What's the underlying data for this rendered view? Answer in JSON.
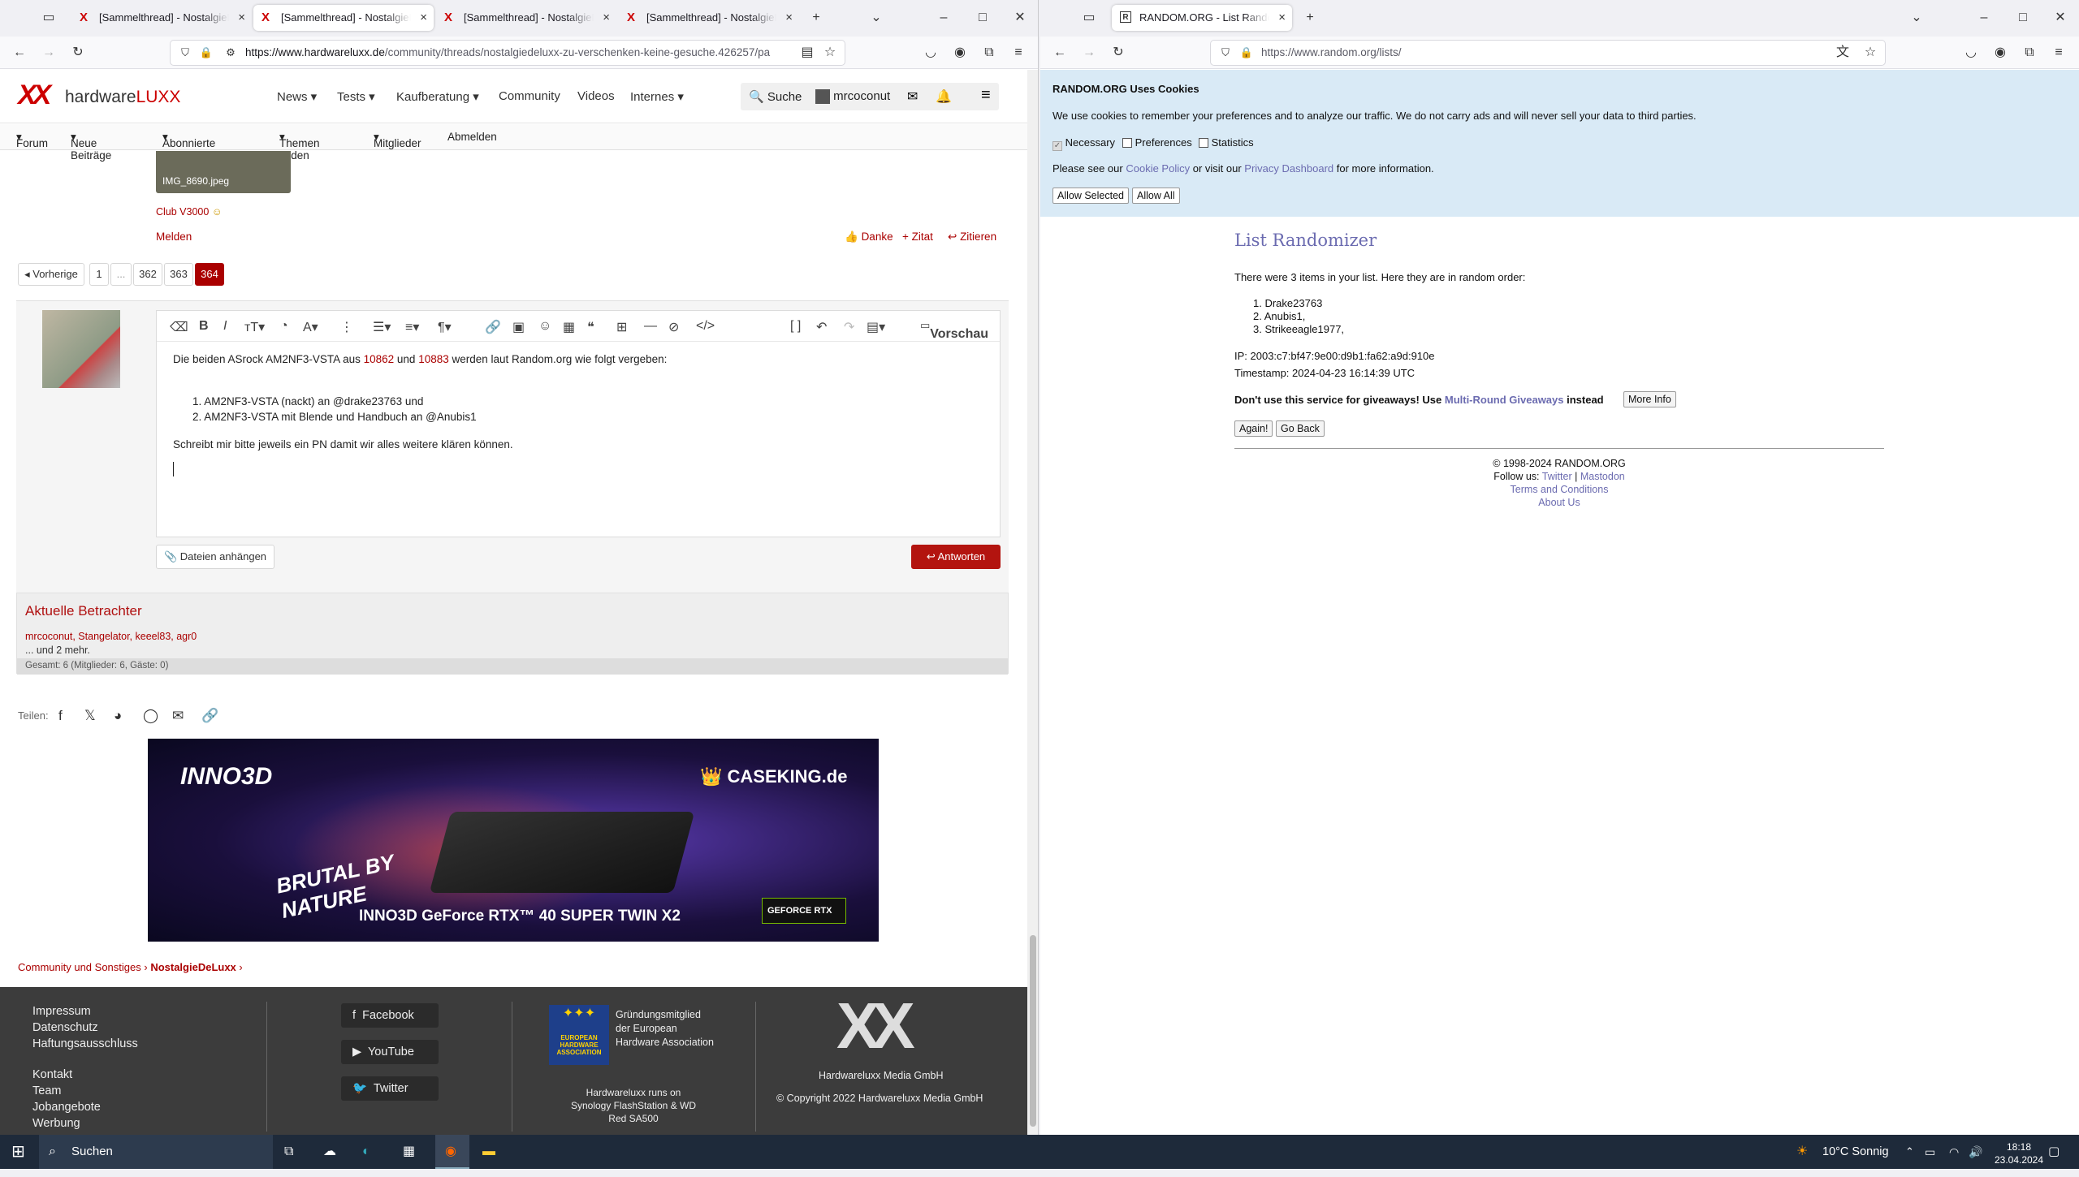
{
  "left_browser": {
    "tabs": [
      {
        "title": "[Sammelthread] - NostalgieDeluxx"
      },
      {
        "title": "[Sammelthread] - NostalgieDeluxx"
      },
      {
        "title": "[Sammelthread] - NostalgieDeluxx"
      },
      {
        "title": "[Sammelthread] - NostalgieDeluxx"
      }
    ],
    "url_host": "https://www.hardwareluxx.de",
    "url_path": "/community/threads/nostalgiedeluxx-zu-verschenken-keine-gesuche.426257/pa"
  },
  "site": {
    "logo_xx": "XX",
    "logo_brand1": "hardware",
    "logo_brand2": "LUXX",
    "nav": [
      "News",
      "Tests",
      "Kaufberatung",
      "Community",
      "Videos",
      "Internes"
    ],
    "search_label": "Suche",
    "user": "mrcoconut",
    "subnav": [
      "Forum",
      "Neue Beiträge",
      "Abonnierte Themen",
      "Themen finden",
      "Mitglieder",
      "Abmelden"
    ],
    "attachment_name": "IMG_8690.jpeg",
    "signature": "Club V3000",
    "report": "Melden",
    "thanks": "Danke",
    "quote_plus": "+ Zitat",
    "quote": "Zitieren",
    "pagination": {
      "prev": "Vorherige",
      "pages": [
        "1",
        "...",
        "362",
        "363",
        "364"
      ]
    },
    "preview": "Vorschau",
    "editor": {
      "line1_a": "Die beiden ASrock AM2NF3-VSTA aus ",
      "link1": "10862",
      "line1_b": " und ",
      "link2": "10883",
      "line1_c": " werden laut Random.org wie folgt vergeben:",
      "item1": "1. AM2NF3-VSTA (nackt) an @drake23763 und",
      "item2": "2. AM2NF3-VSTA mit Blende und Handbuch an @Anubis1",
      "line3": "Schreibt mir bitte jeweils ein PN damit wir alles weitere klären können."
    },
    "attach_btn": "Dateien anhängen",
    "reply_btn": "Antworten",
    "viewers": {
      "title": "Aktuelle Betrachter",
      "names": "mrcoconut, Stangelator, keeel83, agr0",
      "more": "... und 2 mehr.",
      "total": "Gesamt: 6 (Mitglieder: 6, Gäste: 0)"
    },
    "share": "Teilen:",
    "ad": {
      "brand": "INNO3D",
      "shop": "CASEKING.de",
      "slogan": "BRUTAL BY NATURE",
      "product": "INNO3D GeForce RTX™ 40 SUPER TWIN X2",
      "badge": "GEFORCE RTX"
    },
    "breadcrumb": [
      "Community und Sonstiges",
      "NostalgieDeLuxx"
    ],
    "footer": {
      "col1": [
        "Impressum",
        "Datenschutz",
        "Haftungsausschluss"
      ],
      "col1b": [
        "Kontakt",
        "Team",
        "Jobangebote",
        "Werbung"
      ],
      "social": [
        "Facebook",
        "YouTube",
        "Twitter"
      ],
      "eha_text": "Gründungsmitglied der European Hardware Association",
      "eha_logo": "EUROPEAN HARDWARE ASSOCIATION",
      "synology": "Hardwareluxx runs on Synology FlashStation & WD Red SA500",
      "company": "Hardwareluxx Media GmbH",
      "copyright": "© Copyright 2022 Hardwareluxx Media GmbH"
    }
  },
  "right_browser": {
    "tab_title": "RANDOM.ORG - List Randomizer",
    "url": "https://www.random.org/lists/",
    "cookie": {
      "title": "RANDOM.ORG Uses Cookies",
      "text": "We use cookies to remember your preferences and to analyze our traffic. We do not carry ads and will never sell your data to third parties.",
      "necessary": "Necessary",
      "preferences": "Preferences",
      "statistics": "Statistics",
      "see_a": "Please see our ",
      "cookie_policy": "Cookie Policy",
      "see_b": " or visit our ",
      "privacy": "Privacy Dashboard",
      "see_c": " for more information.",
      "allow_selected": "Allow Selected",
      "allow_all": "Allow All"
    },
    "page": {
      "title": "List Randomizer",
      "intro": "There were 3 items in your list. Here they are in random order:",
      "items": [
        "Drake23763",
        "Anubis1,",
        "Strikeeagle1977,"
      ],
      "ip": "IP: 2003:c7:bf47:9e00:d9b1:fa62:a9d:910e",
      "timestamp": "Timestamp: 2024-04-23 16:14:39 UTC",
      "warn_a": "Don't use this service for giveaways! Use ",
      "warn_link": "Multi-Round Giveaways",
      "warn_b": " instead",
      "more_info": "More Info",
      "again": "Again!",
      "go_back": "Go Back",
      "copyright": "© 1998-2024 RANDOM.ORG",
      "follow": "Follow us:",
      "twitter": "Twitter",
      "sep": "|",
      "mastodon": "Mastodon",
      "terms": "Terms and Conditions",
      "about": "About Us"
    }
  },
  "taskbar": {
    "search": "Suchen",
    "weather": "10°C Sonnig",
    "time": "18:18",
    "date": "23.04.2024"
  }
}
